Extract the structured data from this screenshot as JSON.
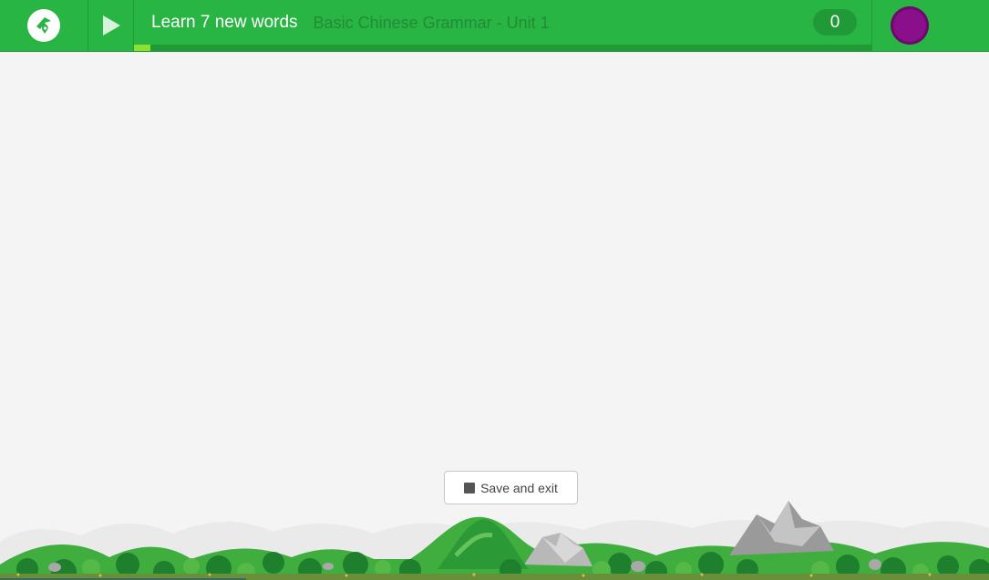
{
  "header": {
    "title": "Learn 7 new words",
    "course": "Basic Chinese Grammar - Unit 1",
    "score": "0",
    "progress_fraction": 0.022
  },
  "actions": {
    "save_exit_label": "Save and exit"
  },
  "icons": {
    "logo": "memrise-logo-icon",
    "play": "play-icon",
    "stop": "stop-icon",
    "avatar": "user-avatar"
  },
  "colors": {
    "header_green": "#28b543",
    "header_dark": "#1f9a37",
    "progress_fill": "#8be22c",
    "avatar": "#8a0f8a",
    "background": "#f4f4f4"
  }
}
